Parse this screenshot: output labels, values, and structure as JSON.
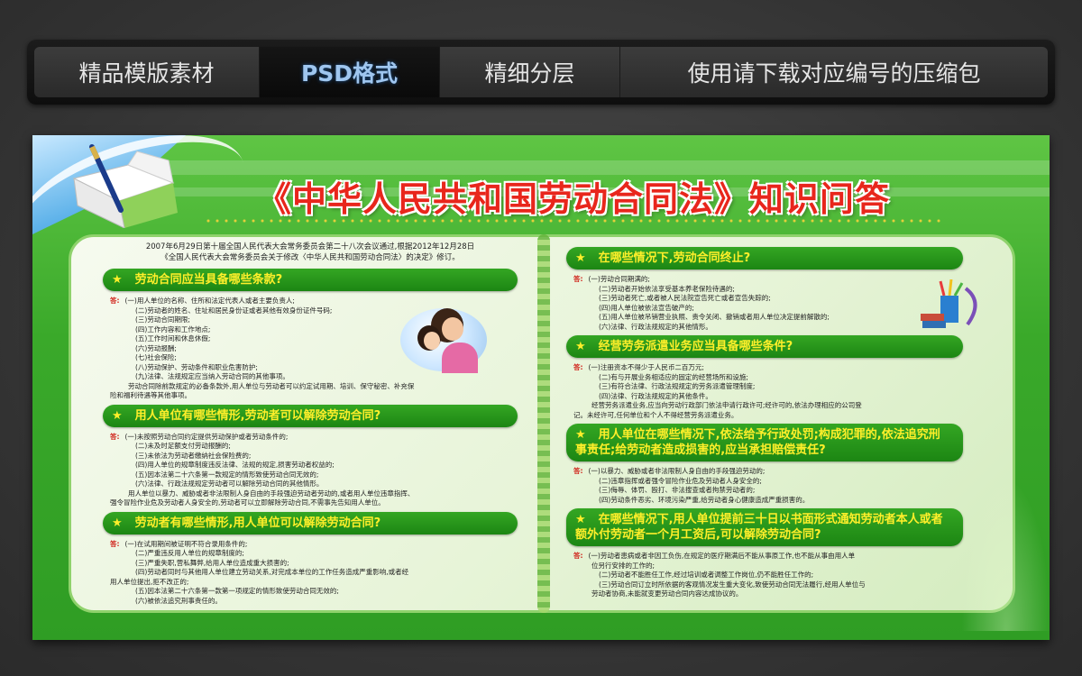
{
  "tabs": [
    {
      "label": "精品模版素材",
      "active": false
    },
    {
      "label": "PSD格式",
      "active": true
    },
    {
      "label": "精细分层",
      "active": false
    },
    {
      "label": "使用请下载对应编号的压缩包",
      "active": false
    }
  ],
  "board": {
    "title": "《中华人民共和国劳动合同法》知识问答",
    "intro": [
      "2007年6月29日第十届全国人民代表大会常务委员会第二十八次会议通过,根据2012年12月28日",
      "《全国人民代表大会常务委员会关于修改〈中华人民共和国劳动合同法〉的决定》修订。"
    ],
    "answer_label": "答:",
    "star": "★",
    "left_questions": [
      {
        "q": "劳动合同应当具备哪些条款?",
        "a": [
          "(一)用人单位的名称、住所和法定代表人或者主要负责人;",
          "(二)劳动者的姓名、住址和居民身份证或者其他有效身份证件号码;",
          "(三)劳动合同期限;",
          "(四)工作内容和工作地点;",
          "(五)工作时间和休息休假;",
          "(六)劳动报酬;",
          "(七)社会保险;",
          "(八)劳动保护、劳动条件和职业危害防护;",
          "(九)法律、法规规定应当纳入劳动合同的其他事项。",
          "劳动合同除前款规定的必备条款外,用人单位与劳动者可以约定试用期、培训、保守秘密、补充保",
          "险和福利待遇等其他事项。"
        ]
      },
      {
        "q": "用人单位有哪些情形,劳动者可以解除劳动合同?",
        "a": [
          "(一)未按照劳动合同约定提供劳动保护或者劳动条件的;",
          "(二)未及时足额支付劳动报酬的;",
          "(三)未依法为劳动者缴纳社会保险费的;",
          "(四)用人单位的规章制度违反法律、法规的规定,损害劳动者权益的;",
          "(五)因本法第二十六条第一款规定的情形致使劳动合同无效的;",
          "(六)法律、行政法规规定劳动者可以解除劳动合同的其他情形。",
          "用人单位以暴力、威胁或者非法限制人身自由的手段强迫劳动者劳动的,或者用人单位违章指挥、",
          "强令冒险作业危及劳动者人身安全的,劳动者可以立即解除劳动合同,不需事先告知用人单位。"
        ]
      },
      {
        "q": "劳动者有哪些情形,用人单位可以解除劳动合同?",
        "a": [
          "(一)在试用期间被证明不符合录用条件的;",
          "(二)严重违反用人单位的规章制度的;",
          "(三)严重失职,营私舞弊,给用人单位造成重大损害的;",
          "(四)劳动者同时与其他用人单位建立劳动关系,对完成本单位的工作任务造成严重影响,或者经",
          "用人单位提出,拒不改正的;",
          "(五)因本法第二十六条第一款第一项规定的情形致使劳动合同无效的;",
          "(六)被依法追究刑事责任的。"
        ]
      }
    ],
    "right_questions": [
      {
        "q": "在哪些情况下,劳动合同终止?",
        "a": [
          "(一)劳动合同期满的;",
          "(二)劳动者开始依法享受基本养老保险待遇的;",
          "(三)劳动者死亡,或者被人民法院宣告死亡或者宣告失踪的;",
          "(四)用人单位被依法宣告破产的;",
          "(五)用人单位被吊销营业执照、责令关闭、撤销或者用人单位决定提前解散的;",
          "(六)法律、行政法规规定的其他情形。"
        ]
      },
      {
        "q": "经营劳务派遣业务应当具备哪些条件?",
        "a": [
          "(一)注册资本不得少于人民币二百万元;",
          "(二)有与开展业务相适应的固定的经营场所和设施;",
          "(三)有符合法律、行政法规规定的劳务派遣管理制度;",
          "(四)法律、行政法规规定的其他条件。",
          "经营劳务派遣业务,应当向劳动行政部门依法申请行政许可;经许可的,依法办理相应的公司登",
          "记。未经许可,任何单位和个人不得经营劳务派遣业务。"
        ]
      },
      {
        "q": "用人单位在哪些情况下,依法给予行政处罚;构成犯罪的,依法追究刑事责任;给劳动者造成损害的,应当承担赔偿责任?",
        "a": [
          "(一)以暴力、威胁或者非法限制人身自由的手段强迫劳动的;",
          "(二)违章指挥或者强令冒险作业危及劳动者人身安全的;",
          "(三)侮辱、体罚、殴打、非法搜查或者拘禁劳动者的;",
          "(四)劳动条件恶劣、环境污染严重,给劳动者身心健康造成严重损害的。"
        ]
      },
      {
        "q": "在哪些情况下,用人单位提前三十日以书面形式通知劳动者本人或者额外付劳动者一个月工资后,可以解除劳动合同?",
        "a": [
          "(一)劳动者患病或者非因工负伤,在规定的医疗期满后不能从事原工作,也不能从事由用人单",
          "位另行安排的工作的;",
          "(二)劳动者不能胜任工作,经过培训或者调整工作岗位,仍不能胜任工作的;",
          "(三)劳动合同订立时所依据的客观情况发生重大变化,致使劳动合同无法履行,经用人单位与",
          "劳动者协商,未能就变更劳动合同内容达成协议的。"
        ]
      }
    ]
  }
}
